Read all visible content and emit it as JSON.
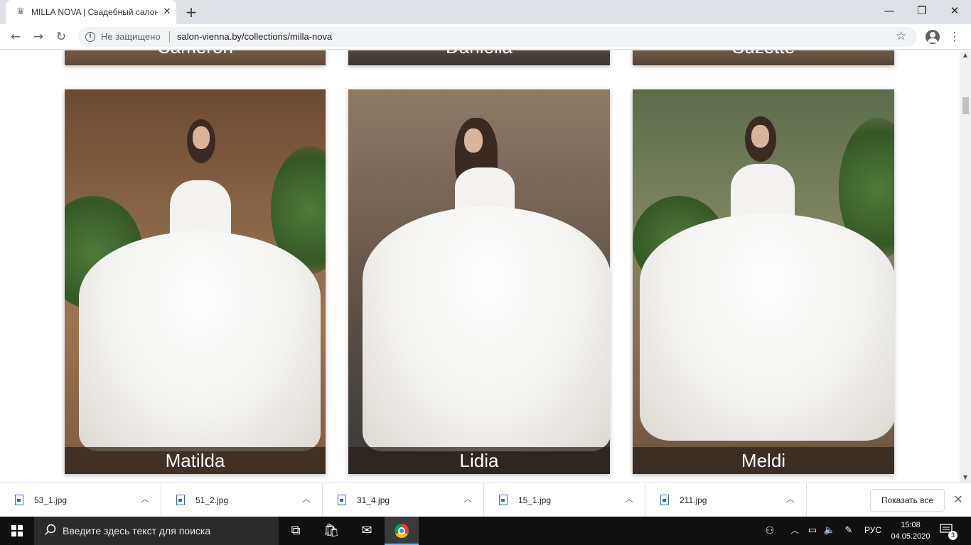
{
  "browser": {
    "tab_title": "MILLA NOVA | Свадебный салон",
    "security_text": "Не защищено",
    "url": "salon-vienna.by/collections/milla-nova"
  },
  "top_row_labels": [
    "Cameron",
    "Daniella",
    "Suzette"
  ],
  "cards": [
    {
      "name": "Matilda"
    },
    {
      "name": "Lidia"
    },
    {
      "name": "Meldi"
    }
  ],
  "downloads": [
    {
      "file": "53_1.jpg"
    },
    {
      "file": "51_2.jpg"
    },
    {
      "file": "31_4.jpg"
    },
    {
      "file": "15_1.jpg"
    },
    {
      "file": "211.jpg"
    }
  ],
  "show_all_label": "Показать все",
  "taskbar": {
    "search_placeholder": "Введите здесь текст для поиска",
    "language": "РУС",
    "time": "15:08",
    "date": "04.05.2020",
    "notifications": "3"
  },
  "colors": {
    "tabbar_bg": "#dee1e6",
    "taskbar_bg": "#101010",
    "card_label_bg": "rgba(40,30,25,0.72)"
  }
}
